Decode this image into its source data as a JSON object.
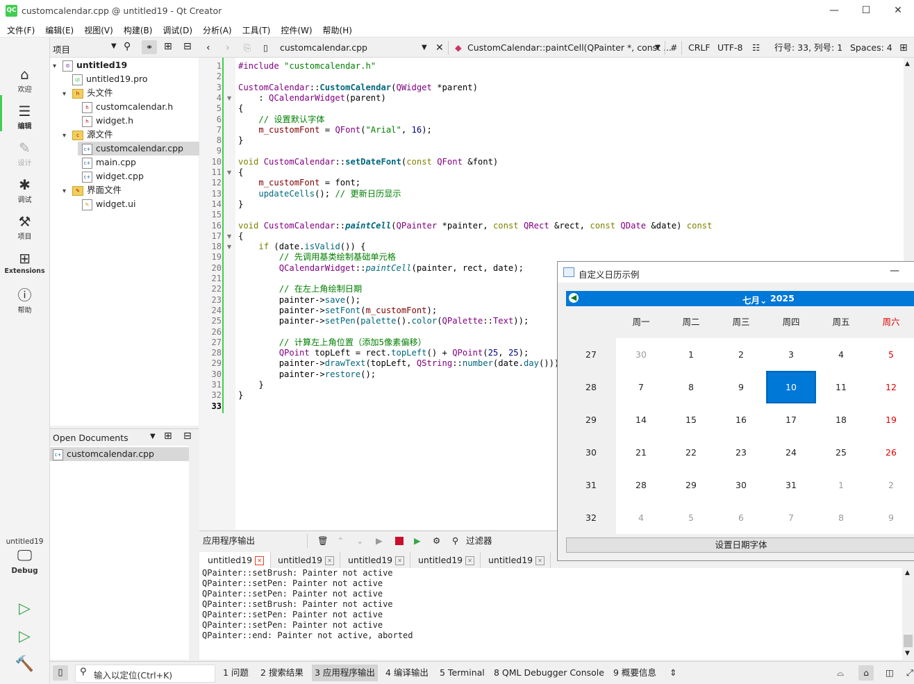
{
  "window": {
    "title": "customcalendar.cpp @ untitled19 - Qt Creator",
    "app_icon": "QC",
    "minimize": "—",
    "maximize": "☐",
    "close": "✕"
  },
  "menu": [
    "文件(F)",
    "编辑(E)",
    "视图(V)",
    "构建(B)",
    "调试(D)",
    "分析(A)",
    "工具(T)",
    "控件(W)",
    "帮助(H)"
  ],
  "modes": [
    {
      "label": "欢迎",
      "icon": "home-icon"
    },
    {
      "label": "编辑",
      "icon": "edit-icon"
    },
    {
      "label": "设计",
      "icon": "design-icon"
    },
    {
      "label": "调试",
      "icon": "bug-icon"
    },
    {
      "label": "项目",
      "icon": "wrench-icon"
    },
    {
      "label": "Extensions",
      "icon": "extensions-icon"
    },
    {
      "label": "帮助",
      "icon": "help-icon"
    }
  ],
  "kit": {
    "project": "untitled19",
    "config": "Debug"
  },
  "project_pane": {
    "header": "项目",
    "tree": [
      {
        "label": "untitled19",
        "level": 0,
        "type": "project",
        "expanded": true
      },
      {
        "label": "untitled19.pro",
        "level": 1,
        "type": "pro"
      },
      {
        "label": "头文件",
        "level": 1,
        "type": "folder",
        "expanded": true
      },
      {
        "label": "customcalendar.h",
        "level": 2,
        "type": "h"
      },
      {
        "label": "widget.h",
        "level": 2,
        "type": "h"
      },
      {
        "label": "源文件",
        "level": 1,
        "type": "folder",
        "expanded": true
      },
      {
        "label": "customcalendar.cpp",
        "level": 2,
        "type": "cpp",
        "selected": true
      },
      {
        "label": "main.cpp",
        "level": 2,
        "type": "cpp"
      },
      {
        "label": "widget.cpp",
        "level": 2,
        "type": "cpp"
      },
      {
        "label": "界面文件",
        "level": 1,
        "type": "folder",
        "expanded": true
      },
      {
        "label": "widget.ui",
        "level": 2,
        "type": "ui"
      }
    ]
  },
  "open_documents": {
    "header": "Open Documents",
    "items": [
      "customcalendar.cpp"
    ]
  },
  "editor_toolbar": {
    "file": "customcalendar.cpp",
    "symbol": "CustomCalendar::paintCell(QPainter *, const ...",
    "hash": "#",
    "line_ending": "CRLF",
    "encoding": "UTF-8",
    "position": "行号: 33, 列号: 1",
    "indent": "Spaces: 4"
  },
  "editor": {
    "line_numbers": [
      "1",
      "2",
      "3",
      "4",
      "5",
      "6",
      "7",
      "8",
      "9",
      "10",
      "11",
      "12",
      "13",
      "14",
      "15",
      "16",
      "17",
      "18",
      "19",
      "20",
      "21",
      "22",
      "23",
      "24",
      "25",
      "26",
      "27",
      "28",
      "29",
      "30",
      "31",
      "32",
      "33"
    ],
    "current_line": 33
  },
  "output": {
    "title": "应用程序输出",
    "filter": "过滤器",
    "tabs": [
      "untitled19",
      "untitled19",
      "untitled19",
      "untitled19",
      "untitled19"
    ],
    "lines": [
      "QPainter::setBrush: Painter not active",
      "QPainter::setPen: Painter not active",
      "QPainter::setPen: Painter not active",
      "QPainter::setBrush: Painter not active",
      "QPainter::setPen: Painter not active",
      "QPainter::setPen: Painter not active",
      "QPainter::end: Painter not active, aborted"
    ]
  },
  "statusbar": {
    "locator_placeholder": "输入以定位(Ctrl+K)",
    "panes": [
      "1  问题",
      "2  搜索结果",
      "3  应用程序输出",
      "4  编译输出",
      "5  Terminal",
      "8  QML Debugger Console",
      "9  概要信息"
    ]
  },
  "calendar": {
    "window_title": "自定义日历示例",
    "month": "七月",
    "year": "2025",
    "weekdays": [
      "周一",
      "周二",
      "周三",
      "周四",
      "周五",
      "周六"
    ],
    "week_numbers": [
      "27",
      "28",
      "29",
      "30",
      "31",
      "32"
    ],
    "weeks": [
      [
        "30",
        "1",
        "2",
        "3",
        "4",
        "5"
      ],
      [
        "7",
        "8",
        "9",
        "10",
        "11",
        "12"
      ],
      [
        "14",
        "15",
        "16",
        "17",
        "18",
        "19"
      ],
      [
        "21",
        "22",
        "23",
        "24",
        "25",
        "26"
      ],
      [
        "28",
        "29",
        "30",
        "31",
        "1",
        "2"
      ],
      [
        "4",
        "5",
        "6",
        "7",
        "8",
        "9"
      ]
    ],
    "selected": "10",
    "button": "设置日期字体",
    "weekend_color": "#e00000",
    "selected_color": "#0078d7"
  }
}
